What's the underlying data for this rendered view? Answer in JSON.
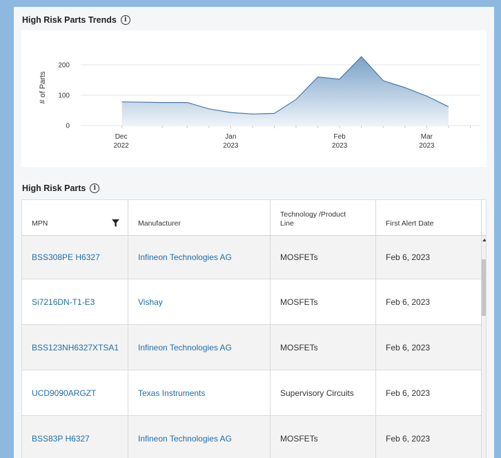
{
  "trends": {
    "title": "High Risk Parts Trends",
    "info_icon": "info-icon"
  },
  "chart_data": {
    "type": "area",
    "ylabel": "# of Parts",
    "xlabel": "",
    "yticks": [
      "0",
      "100",
      "200"
    ],
    "ylim": [
      0,
      250
    ],
    "grid": true,
    "x_tick_labels": [
      {
        "month": "Dec",
        "year": "2022"
      },
      {
        "month": "Jan",
        "year": "2023"
      },
      {
        "month": "Feb",
        "year": "2023"
      },
      {
        "month": "Mar",
        "year": "2023"
      }
    ],
    "x": [
      "2022-12-01",
      "2022-12-14",
      "2022-12-22",
      "2022-12-29",
      "2023-01-05",
      "2023-01-12",
      "2023-01-19",
      "2023-01-26",
      "2023-02-02",
      "2023-02-09",
      "2023-02-16",
      "2023-02-23",
      "2023-03-02",
      "2023-03-09",
      "2023-03-16"
    ],
    "values": [
      78,
      76,
      76,
      55,
      43,
      38,
      40,
      86,
      160,
      153,
      227,
      148,
      125,
      97,
      62
    ],
    "colors": {
      "line": "#4a78a6",
      "fill_top": "#7aa2c8",
      "fill_bottom": "#eef3f9"
    }
  },
  "parts": {
    "title": "High Risk Parts",
    "columns": [
      "MPN",
      "Manufacturer",
      "Technology /Product Line",
      "First Alert Date"
    ],
    "rows": [
      {
        "mpn": "BSS308PE H6327",
        "manufacturer": "Infineon Technologies AG",
        "tech": "MOSFETs",
        "date": "Feb 6, 2023"
      },
      {
        "mpn": "Si7216DN-T1-E3",
        "manufacturer": "Vishay",
        "tech": "MOSFETs",
        "date": "Feb 6, 2023"
      },
      {
        "mpn": "BSS123NH6327XTSA1",
        "manufacturer": "Infineon Technologies AG",
        "tech": "MOSFETs",
        "date": "Feb 6, 2023"
      },
      {
        "mpn": "UCD9090ARGZT",
        "manufacturer": "Texas Instruments",
        "tech": "Supervisory Circuits",
        "date": "Feb 6, 2023"
      },
      {
        "mpn": "BSS83P H6327",
        "manufacturer": "Infineon Technologies AG",
        "tech": "MOSFETs",
        "date": "Feb 6, 2023"
      }
    ]
  },
  "colors": {
    "link": "#1f6fa8",
    "page_bg": "#8db8e0"
  }
}
